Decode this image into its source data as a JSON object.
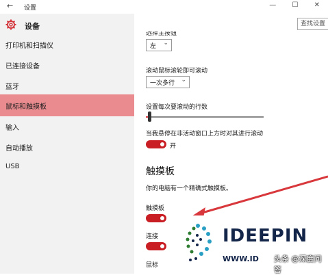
{
  "window": {
    "title": "设置",
    "back_glyph": "←",
    "controls": "— ☐ ✕"
  },
  "sidebar": {
    "header_label": "设备",
    "items": [
      {
        "label": "打印机和扫描仪"
      },
      {
        "label": "已连接设备"
      },
      {
        "label": "蓝牙"
      },
      {
        "label": "鼠标和触摸板"
      },
      {
        "label": "输入"
      },
      {
        "label": "自动播放"
      },
      {
        "label": "USB"
      }
    ],
    "active_index": 3
  },
  "search": {
    "placeholder": "查找设置"
  },
  "content": {
    "cut_label": "选择主按钮",
    "primary_button_value": "左",
    "scroll_label": "滚动鼠标滚轮即可滚动",
    "scroll_value": "一次多行",
    "lines_label": "设置每次要滚动的行数",
    "lines_level": 0.02,
    "inactive_scroll_label": "当我悬停在非活动窗口上方时对其进行滚动",
    "inactive_scroll_state": "开",
    "touchpad_title": "触摸板",
    "touchpad_desc": "你的电脑有一个精确式触摸板。",
    "touchpad_label": "触摸板",
    "connect_label": "连接",
    "mouse_label": "鼠标"
  },
  "overlay": {
    "brand": "IDEEPIN",
    "url": "WWW.ID",
    "watermark": "头条 @深度问答"
  },
  "colors": {
    "accent": "#c81e24",
    "sidebar_active": "#e98b8f",
    "brand": "#14254a"
  }
}
